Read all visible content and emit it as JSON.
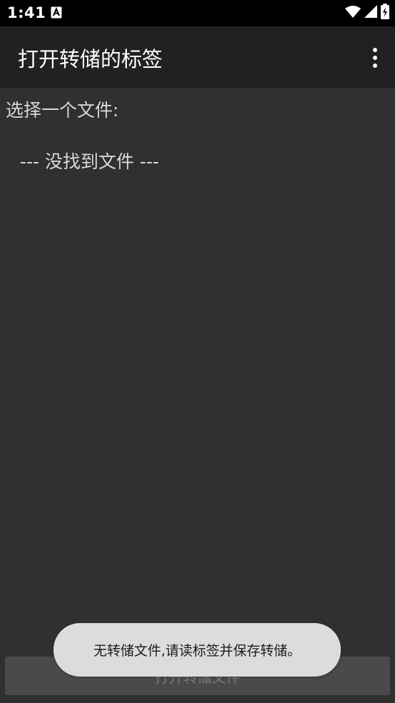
{
  "status_bar": {
    "time": "1:41",
    "notification_icon": "font-a-icon",
    "icons": [
      "wifi-icon",
      "signal-icon",
      "battery-charging-icon"
    ]
  },
  "app_bar": {
    "title": "打开转储的标签",
    "menu_icon": "more-vert-icon"
  },
  "content": {
    "select_label": "选择一个文件:",
    "empty_item": "--- 没找到文件 ---"
  },
  "bottom_button": {
    "label": "打开转储文件"
  },
  "toast": {
    "message": "无转储文件,请读标签并保存转储。"
  },
  "colors": {
    "background": "#303030",
    "app_bar": "#212121",
    "status_bar": "#000000",
    "toast_bg": "#dcdcdc"
  }
}
